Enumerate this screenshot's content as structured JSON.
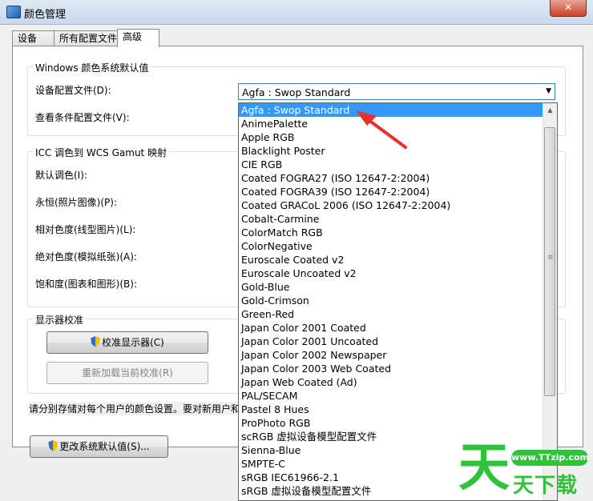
{
  "window": {
    "title": "颜色管理",
    "close_label": "✕"
  },
  "tabs": [
    {
      "label": "设备"
    },
    {
      "label": "所有配置文件"
    },
    {
      "label": "高级"
    }
  ],
  "windows_defaults": {
    "title": "Windows 颜色系统默认值",
    "device_profile_label": "设备配置文件(D):",
    "viewing_conditions_label": "查看条件配置文件(V):",
    "selected_profile": "Agfa : Swop Standard"
  },
  "icc_mapping": {
    "title": "ICC 调色到 WCS Gamut 映射",
    "default_label": "默认调色(I):",
    "perceptual_label": "永恒(照片图像)(P):",
    "relative_label": "相对色度(线型图片)(L):",
    "absolute_label": "绝对色度(模拟纸张)(A):",
    "saturation_label": "饱和度(图表和图形)(B):"
  },
  "calibration": {
    "title": "显示器校准",
    "calibrate_button": "校准显示器(C)",
    "reload_button": "重新加载当前校准(R)"
  },
  "note": "请分别存储对每个用户的颜色设置。要对新用户和",
  "change_defaults_button": "更改系统默认值(S)...",
  "dropdown": {
    "items": [
      "Agfa : Swop Standard",
      "AnimePalette",
      "Apple RGB",
      "Blacklight Poster",
      "CIE RGB",
      "Coated FOGRA27 (ISO 12647-2:2004)",
      "Coated FOGRA39 (ISO 12647-2:2004)",
      "Coated GRACoL 2006 (ISO 12647-2:2004)",
      "Cobalt-Carmine",
      "ColorMatch RGB",
      "ColorNegative",
      "Euroscale Coated v2",
      "Euroscale Uncoated v2",
      "Gold-Blue",
      "Gold-Crimson",
      "Green-Red",
      "Japan Color 2001 Coated",
      "Japan Color 2001 Uncoated",
      "Japan Color 2002 Newspaper",
      "Japan Color 2003 Web Coated",
      "Japan Web Coated (Ad)",
      "PAL/SECAM",
      "Pastel 8 Hues",
      "ProPhoto RGB",
      "scRGB 虚拟设备模型配置文件",
      "Sienna-Blue",
      "SMPTE-C",
      "sRGB IEC61966-2.1",
      "sRGB 虚拟设备模型配置文件"
    ],
    "selected_index": 0
  },
  "watermark": {
    "logo": "天",
    "url": "www.TTzip.com",
    "text": "天下载"
  },
  "colors": {
    "selection": "#3399ff",
    "annotation_arrow": "#e8312f",
    "watermark": "#2fc23a"
  }
}
